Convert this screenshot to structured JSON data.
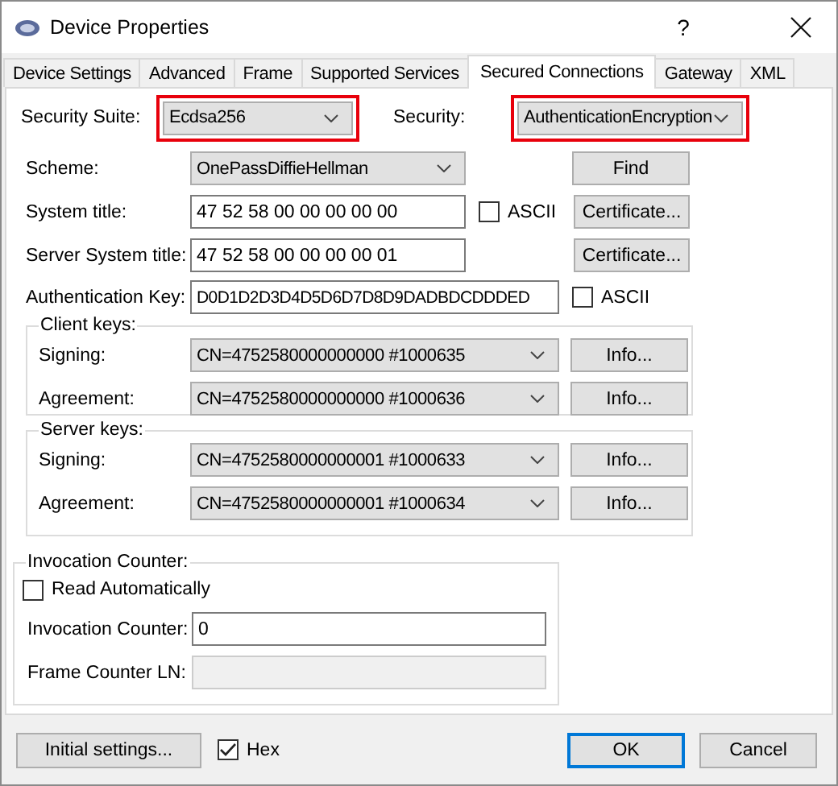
{
  "window": {
    "title": "Device Properties",
    "help": "?"
  },
  "tabs": [
    {
      "label": "Device Settings",
      "selected": false
    },
    {
      "label": "Advanced",
      "selected": false
    },
    {
      "label": "Frame",
      "selected": false
    },
    {
      "label": "Supported Services",
      "selected": false
    },
    {
      "label": "Secured Connections",
      "selected": true
    },
    {
      "label": "Gateway",
      "selected": false
    },
    {
      "label": "XML",
      "selected": false
    }
  ],
  "security_suite": {
    "label": "Security Suite:",
    "value": "Ecdsa256",
    "highlighted": true
  },
  "security": {
    "label": "Security:",
    "value": "AuthenticationEncryption",
    "highlighted": true
  },
  "scheme": {
    "label": "Scheme:",
    "value": "OnePassDiffieHellman",
    "button": "Find"
  },
  "system_title": {
    "label": "System title:",
    "value": "47 52 58 00 00 00 00 00",
    "ascii": {
      "label": "ASCII",
      "checked": false
    },
    "button": "Certificate..."
  },
  "server_system_title": {
    "label": "Server System title:",
    "value": "47 52 58 00 00 00 00 01",
    "button": "Certificate..."
  },
  "authentication_key": {
    "label": "Authentication Key:",
    "value": "D0D1D2D3D4D5D6D7D8D9DADBDCDDDED",
    "ascii": {
      "label": "ASCII",
      "checked": false
    }
  },
  "key_groups": [
    {
      "title": "Client keys:",
      "rows": [
        {
          "label": "Signing:",
          "value": "CN=4752580000000000 #1000635",
          "button": "Info..."
        },
        {
          "label": "Agreement:",
          "value": "CN=4752580000000000 #1000636",
          "button": "Info..."
        }
      ]
    },
    {
      "title": "Server keys:",
      "rows": [
        {
          "label": "Signing:",
          "value": "CN=4752580000000001 #1000633",
          "button": "Info..."
        },
        {
          "label": "Agreement:",
          "value": "CN=4752580000000001 #1000634",
          "button": "Info..."
        }
      ]
    }
  ],
  "invocation_counter": {
    "title": "Invocation Counter:",
    "read_automatically": {
      "label": "Read Automatically",
      "checked": false
    },
    "fields": [
      {
        "label": "Invocation Counter:",
        "value": "0",
        "disabled": false
      },
      {
        "label": "Frame Counter LN:",
        "disabled": true
      }
    ]
  },
  "footer": {
    "initial_settings": "Initial settings...",
    "hex": {
      "label": "Hex",
      "checked": true
    },
    "buttons": [
      {
        "label": "OK",
        "default": true
      },
      {
        "label": "Cancel",
        "default": false
      }
    ]
  }
}
